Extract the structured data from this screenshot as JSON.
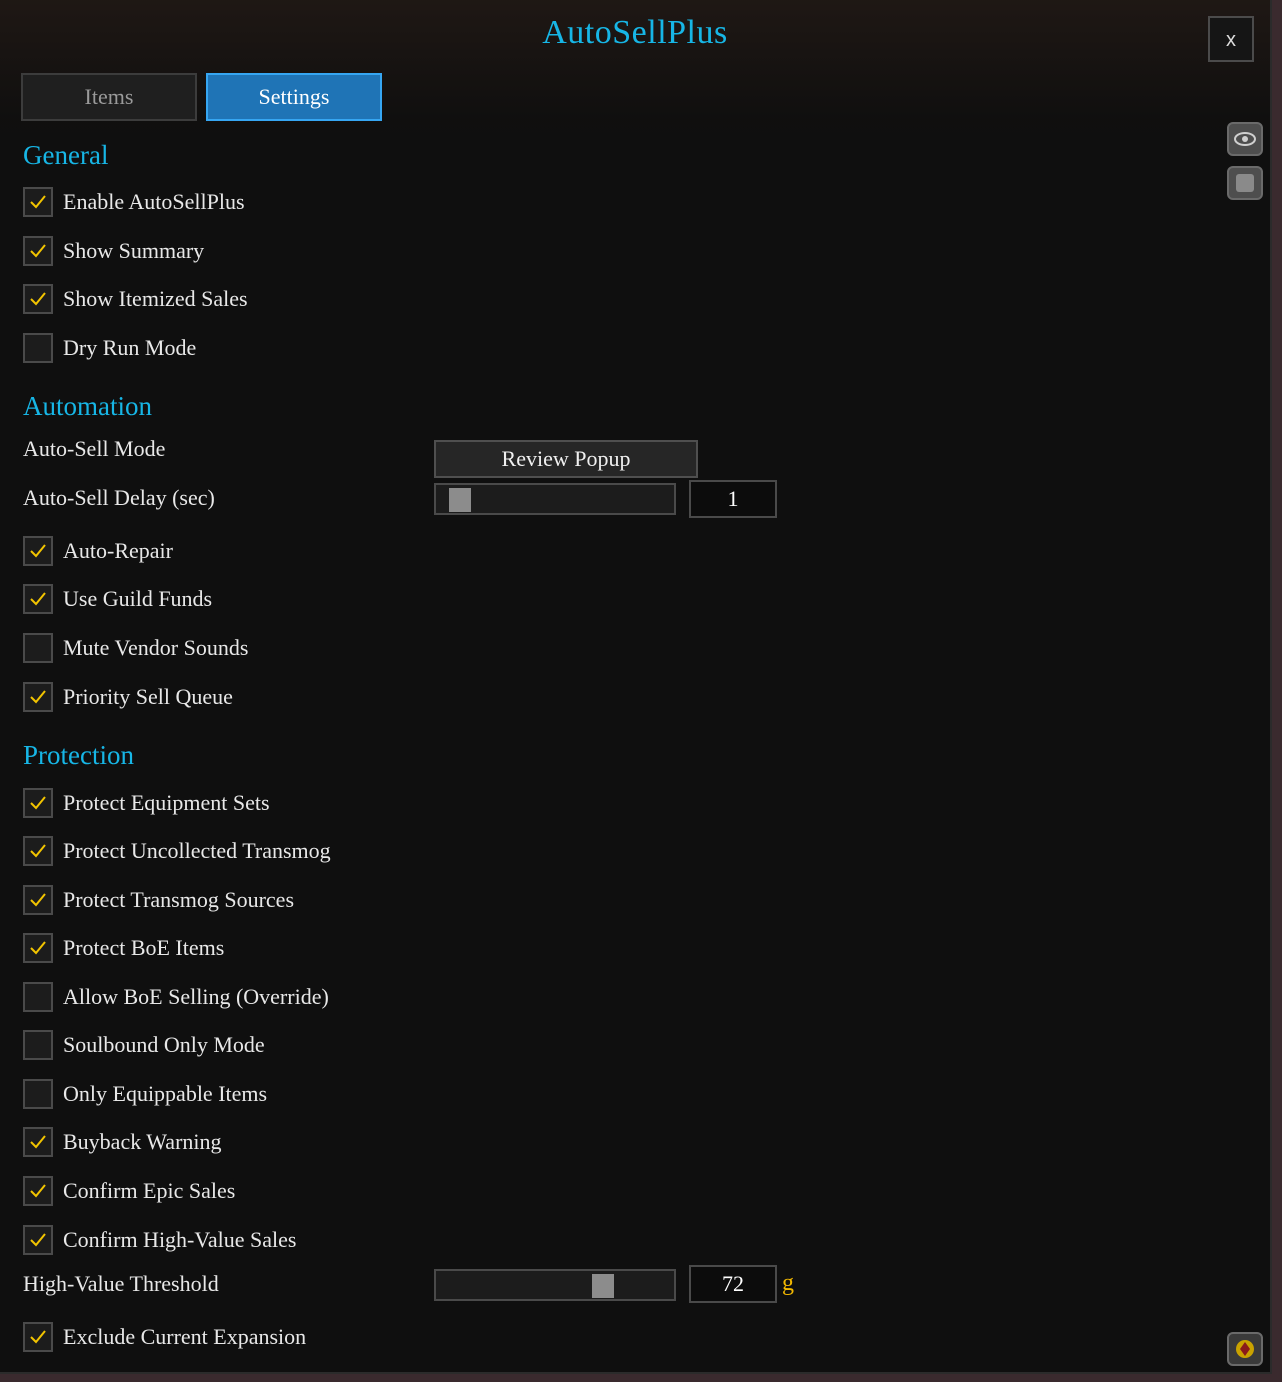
{
  "window": {
    "title": "AutoSellPlus",
    "close_label": "x"
  },
  "tabs": [
    {
      "label": "Items",
      "active": false
    },
    {
      "label": "Settings",
      "active": true
    }
  ],
  "colors": {
    "accent": "#17b6e6",
    "tab_active": "#1f74b6",
    "check": "#f2c400",
    "gold": "#f2b800"
  },
  "general": {
    "heading": "General",
    "options": [
      {
        "label": "Enable AutoSellPlus",
        "checked": true
      },
      {
        "label": "Show Summary",
        "checked": true
      },
      {
        "label": "Show Itemized Sales",
        "checked": true
      },
      {
        "label": "Dry Run Mode",
        "checked": false
      }
    ]
  },
  "automation": {
    "heading": "Automation",
    "mode_label": "Auto-Sell Mode",
    "mode_value": "Review Popup",
    "delay_label": "Auto-Sell Delay (sec)",
    "delay_value": "1",
    "delay_fraction": 0.06,
    "options": [
      {
        "label": "Auto-Repair",
        "checked": true
      },
      {
        "label": "Use Guild Funds",
        "checked": true
      },
      {
        "label": "Mute Vendor Sounds",
        "checked": false
      },
      {
        "label": "Priority Sell Queue",
        "checked": true
      }
    ]
  },
  "protection": {
    "heading": "Protection",
    "options": [
      {
        "label": "Protect Equipment Sets",
        "checked": true
      },
      {
        "label": "Protect Uncollected Transmog",
        "checked": true
      },
      {
        "label": "Protect Transmog Sources",
        "checked": true
      },
      {
        "label": "Protect BoE Items",
        "checked": true
      },
      {
        "label": "Allow BoE Selling (Override)",
        "checked": false
      },
      {
        "label": "Soulbound Only Mode",
        "checked": false
      },
      {
        "label": "Only Equippable Items",
        "checked": false
      },
      {
        "label": "Buyback Warning",
        "checked": true
      },
      {
        "label": "Confirm Epic Sales",
        "checked": true
      },
      {
        "label": "Confirm High-Value Sales",
        "checked": true
      }
    ],
    "threshold_label": "High-Value Threshold",
    "threshold_value": "72",
    "threshold_unit": "g",
    "threshold_fraction": 0.72,
    "exclude_label": "Exclude Current Expansion",
    "exclude_checked": true
  },
  "side_icons": [
    "eye-icon",
    "square-icon",
    "gem-icon"
  ]
}
